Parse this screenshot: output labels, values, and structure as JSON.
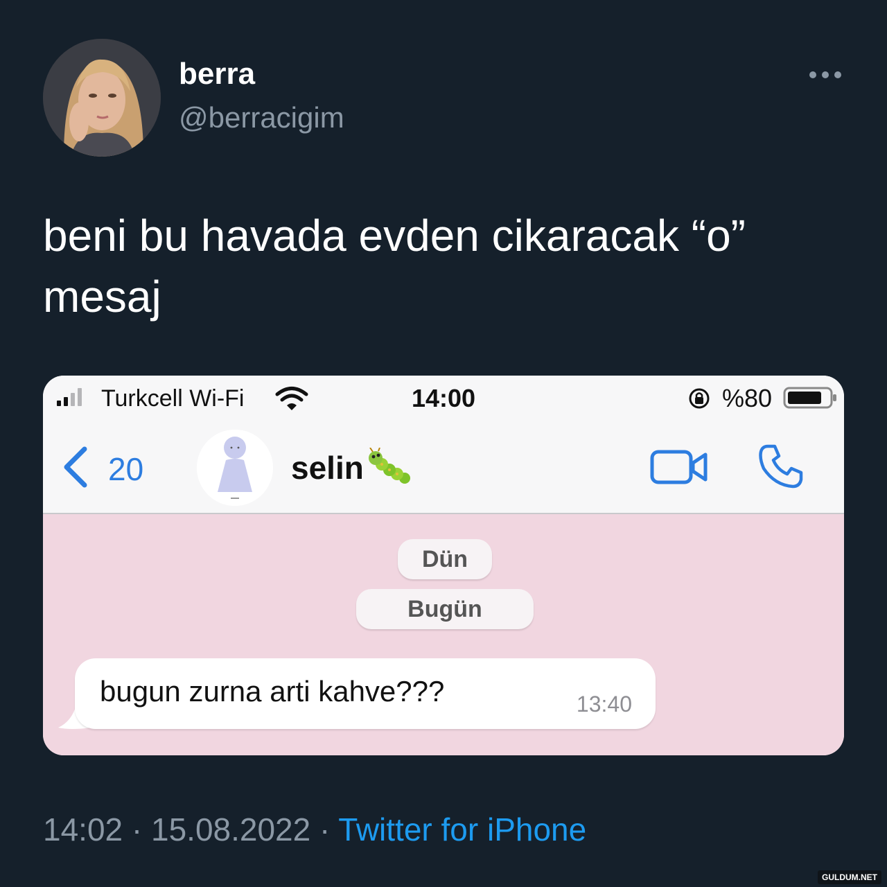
{
  "tweet": {
    "display_name": "berra",
    "handle": "@berracigim",
    "text_line1": "beni bu havada evden cikaracak “o”",
    "text_line2": "mesaj",
    "timestamp": "14:02 · 15.08.2022 · ",
    "source": "Twitter for iPhone",
    "more_icon": "more-horizontal-icon"
  },
  "screenshot": {
    "statusbar": {
      "carrier": "Turkcell Wi-Fi",
      "time": "14:00",
      "battery": "%80"
    },
    "navbar": {
      "back_count": "20",
      "contact_name": "selin",
      "accent_color": "#2d7de0"
    },
    "chat": {
      "date_pills": [
        "Dün",
        "Bugün"
      ],
      "messages": [
        {
          "text": "bugun zurna arti kahve???",
          "time": "13:40",
          "incoming": true
        }
      ],
      "background_color": "#f1d6e0"
    }
  },
  "watermark": "GULDUM.NET"
}
